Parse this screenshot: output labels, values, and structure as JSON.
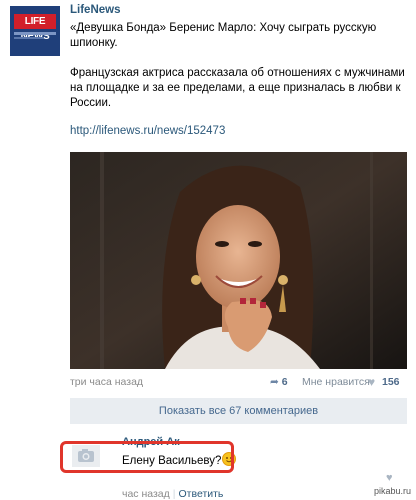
{
  "post": {
    "author": "LifeNews",
    "title_line": "«Девушка Бонда» Беренис Марло: Хочу сыграть русскую шпионку.",
    "body_line": "Французская актриса рассказала об отношениях с мужчинами на площадке и за ее пределами, а еще призналась в любви к России.",
    "link": "http://lifenews.ru/news/152473",
    "avatar_logo": "LIFE NEWS"
  },
  "meta": {
    "time": "три часа назад",
    "reposts": "6",
    "like_label": "Мне нравится",
    "likes": "156"
  },
  "comments_button": "Показать все 67 комментариев",
  "comment": {
    "author": "Андрей Ак",
    "text": "Елену Васильеву?",
    "time": "час назад",
    "reply": "Ответить"
  },
  "watermark": "pikabu.ru",
  "colors": {
    "link": "#2b587a",
    "highlight": "#e0352b",
    "button_bg": "#e9edf1"
  },
  "icons": [
    "camera-icon",
    "repost-icon",
    "heart-icon",
    "smile-emoji-icon"
  ]
}
